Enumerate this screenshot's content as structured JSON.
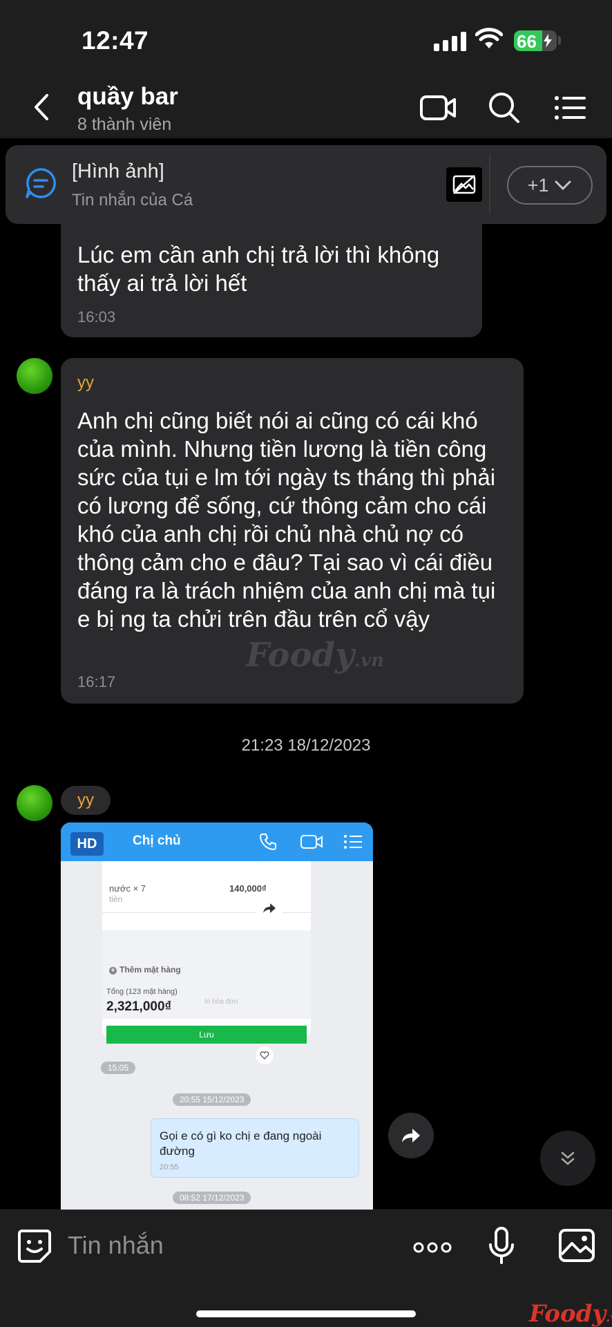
{
  "status": {
    "time": "12:47",
    "battery": "66",
    "battery_level": 0.66
  },
  "header": {
    "title": "quầy bar",
    "subtitle": "8 thành viên"
  },
  "pinned": {
    "title": "[Hình ảnh]",
    "subtitle": "Tin nhắn của Cá",
    "more_count": "+1"
  },
  "messages": [
    {
      "text": "Lúc em cần anh chị trả lời thì không thấy ai trả lời hết",
      "time": "16:03"
    },
    {
      "sender": "yy",
      "text": "Anh chị cũng biết nói ai cũng có cái khó của mình. Nhưng tiền lương là tiền công sức của tụi e lm tới ngày ts tháng thì phải có lương để sống, cứ thông cảm cho cái khó của anh chị rồi chủ nhà chủ nợ có thông cảm cho e đâu? Tại sao vì cái điều đáng ra là trách nhiệm của anh chị mà tụi e bị ng ta chửi trên đầu trên cổ vậy",
      "time": "16:17"
    }
  ],
  "date_separator": "21:23 18/12/2023",
  "image_message": {
    "sender": "yy",
    "screenshot": {
      "badge": "HD",
      "contact": "Chị chủ",
      "item_line": "nước × 7",
      "item_price": "140,000₫",
      "item_sub": "tiền",
      "add_item": "Thêm mặt hàng",
      "total_label": "Tổng (123 mặt hàng)",
      "total_value": "2,321,000₫",
      "print_label": "In hóa đơn",
      "save_label": "Lưu",
      "card_time": "15:05",
      "date_pill_1": "20:55 15/12/2023",
      "bubble_text": "Gọi e có gì ko chị e đang ngoài đường",
      "bubble_time": "20:55",
      "date_pill_2": "08:52 17/12/2023"
    }
  },
  "watermark": {
    "main": "Foody",
    "suffix": ".vn"
  },
  "composer": {
    "placeholder": "Tin nhắn"
  },
  "foody_logo": {
    "main": "Foody",
    "suffix": ".vn"
  }
}
